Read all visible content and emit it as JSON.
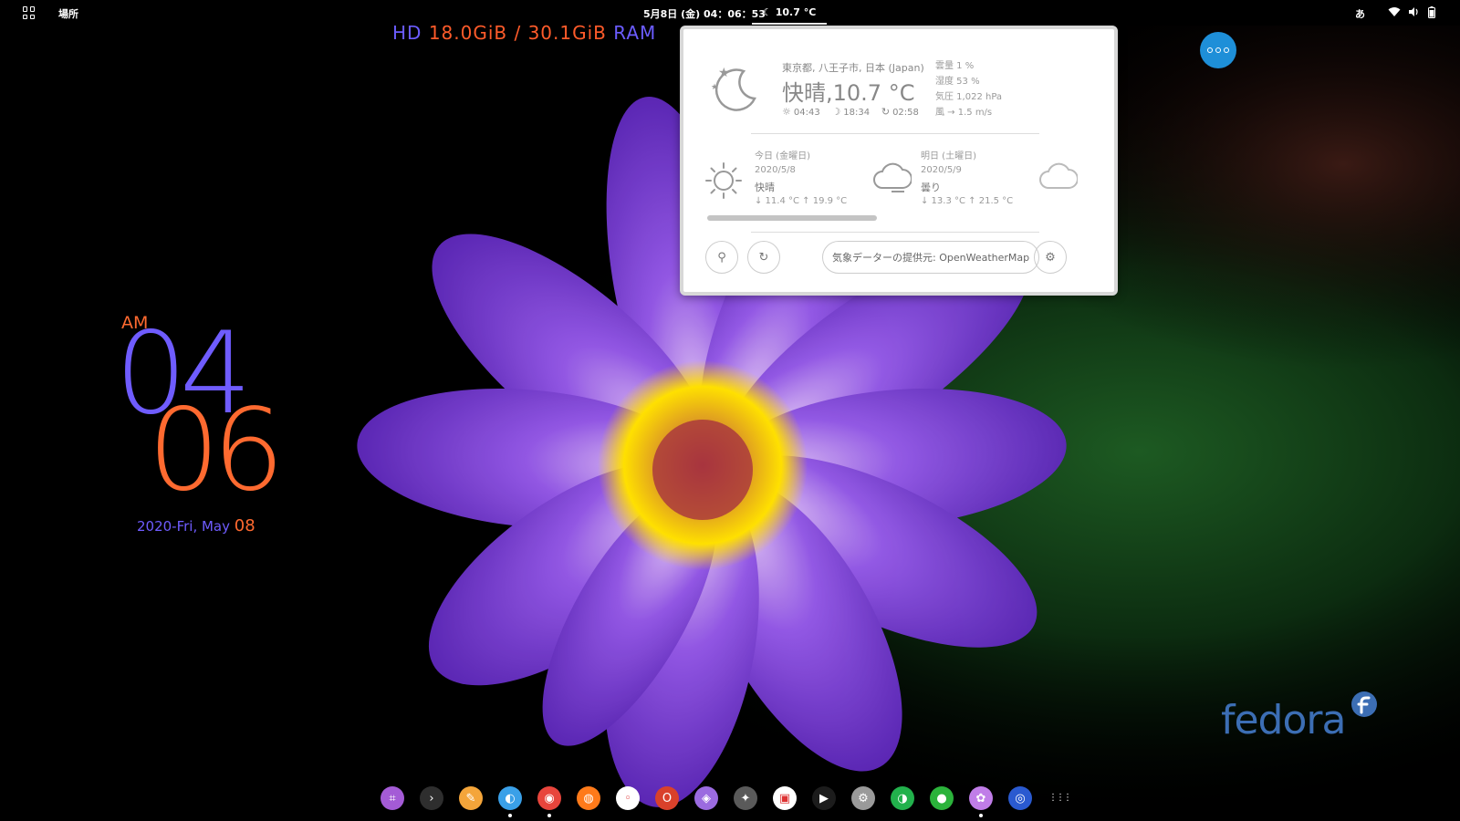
{
  "topbar": {
    "places": "場所",
    "clock": "5月8日 (金)  04：06：53",
    "weather": "10.7 °C",
    "ime": "あ"
  },
  "sysmon": {
    "hd_label": "HD",
    "hd_value": "18.0GiB / 30.1GiB",
    "ram_label": "RAM"
  },
  "clock_widget": {
    "ampm": "AM",
    "hour": "04",
    "minute": "06",
    "date": "2020-Fri, May ",
    "day": "08"
  },
  "fedora": {
    "text": "fedora"
  },
  "weather": {
    "location": "東京都, 八王子市, 日本 (Japan)",
    "summary": "快晴,10.7 °C",
    "sunrise": "04:43",
    "sunset": "18:34",
    "updated": "02:58",
    "details": {
      "cloud": "雲量 1 %",
      "humidity": "湿度 53 %",
      "pressure": "気圧 1,022 hPa",
      "wind": "風 → 1.5 m/s"
    },
    "today": {
      "label": "今日 (金曜日)",
      "date": "2020/5/8",
      "condition": "快晴",
      "temps": "↓ 11.4 °C    ↑ 19.9 °C"
    },
    "tomorrow": {
      "label": "明日 (土曜日)",
      "date": "2020/5/9",
      "condition": "曇り",
      "temps": "↓ 13.3 °C    ↑ 21.5 °C"
    },
    "provider": "気象データーの提供元: OpenWeatherMap"
  },
  "dock": [
    {
      "name": "screenshot",
      "color": "#a45bd6",
      "glyph": "⌗",
      "running": false
    },
    {
      "name": "terminal",
      "color": "#2e2e2e",
      "glyph": "›",
      "running": false
    },
    {
      "name": "notes",
      "color": "#f4a53a",
      "glyph": "✎",
      "running": false
    },
    {
      "name": "file-manager",
      "color": "#3aa0e8",
      "glyph": "◐",
      "running": true
    },
    {
      "name": "chrome",
      "color": "#e8453c",
      "glyph": "◉",
      "running": true
    },
    {
      "name": "firefox",
      "color": "#ff7a1a",
      "glyph": "◍",
      "running": false
    },
    {
      "name": "media",
      "color": "#ffffff",
      "glyph": "◦",
      "running": false
    },
    {
      "name": "office",
      "color": "#d9412b",
      "glyph": "O",
      "running": false
    },
    {
      "name": "photo-app",
      "color": "#9b6be0",
      "glyph": "◈",
      "running": false
    },
    {
      "name": "gimp",
      "color": "#5a5a5a",
      "glyph": "✦",
      "running": false
    },
    {
      "name": "mail",
      "color": "#ffffff",
      "glyph": "▣",
      "running": false
    },
    {
      "name": "video-player",
      "color": "#1c1c1c",
      "glyph": "▶",
      "running": false
    },
    {
      "name": "settings",
      "color": "#9a9a9a",
      "glyph": "⚙",
      "running": false
    },
    {
      "name": "tweaks",
      "color": "#22b14c",
      "glyph": "◑",
      "running": false
    },
    {
      "name": "software",
      "color": "#2bb33b",
      "glyph": "●",
      "running": false
    },
    {
      "name": "flower-app",
      "color": "#c07de8",
      "glyph": "✿",
      "running": true
    },
    {
      "name": "app-store",
      "color": "#2a5ad0",
      "glyph": "◎",
      "running": false
    },
    {
      "name": "show-apps",
      "color": "transparent",
      "glyph": "⋮⋮⋮",
      "running": false
    }
  ]
}
